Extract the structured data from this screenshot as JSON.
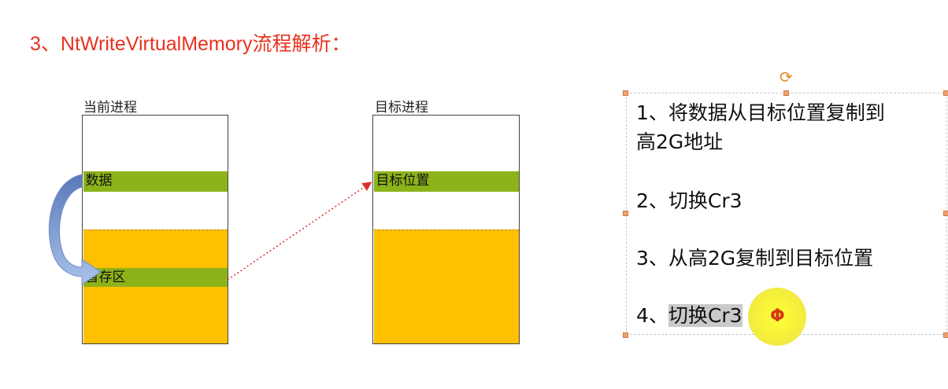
{
  "title": "3、NtWriteVirtualMemory流程解析：",
  "diagram": {
    "current_process": {
      "label": "当前进程",
      "data_label": "数据",
      "temp_label": "暂存区"
    },
    "target_process": {
      "label": "目标进程",
      "target_label": "目标位置"
    }
  },
  "steps": {
    "s1_line1": "1、将数据从目标位置复制到",
    "s1_line2": "高2G地址",
    "s2": "2、切换Cr3",
    "s3": "3、从高2G复制到目标位置",
    "s4_prefix": "4、",
    "s4_highlight": "切换Cr3"
  },
  "icons": {
    "rotate_handle": "rotate-handle-icon",
    "cursor": "text-cursor-icon"
  },
  "colors": {
    "title": "#e8321e",
    "green_band": "#8db31a",
    "yellow_area": "#ffc000",
    "arrow_red": "#d93030",
    "handle": "#f0a070"
  }
}
